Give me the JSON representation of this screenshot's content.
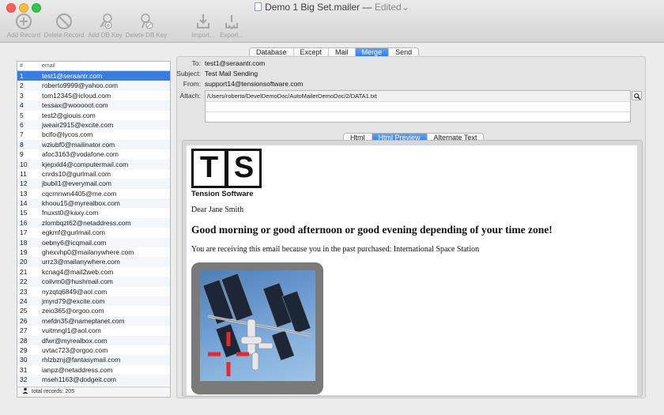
{
  "window": {
    "title": "Demo 1 Big Set.mailer",
    "separator": "—",
    "status": "Edited",
    "status_arrow": "⌄"
  },
  "toolbar": {
    "add_record": "Add Record",
    "delete_record": "Delete Record",
    "add_db_key": "Add DB Key",
    "delete_db_key": "Delete DB Key",
    "import": "Import...",
    "export": "Export..."
  },
  "main_tabs": {
    "database": "Database",
    "except": "Except",
    "mail": "Mail",
    "merge": "Merge",
    "send": "Send",
    "active": "Merge"
  },
  "list": {
    "col_num": "#",
    "col_email": "email",
    "rows": [
      {
        "n": "1",
        "email": "test1@seraantr.com"
      },
      {
        "n": "2",
        "email": "roberto9999@yahoo.com"
      },
      {
        "n": "3",
        "email": "tom12345@icloud.com"
      },
      {
        "n": "4",
        "email": "tessax@wooooot.com"
      },
      {
        "n": "5",
        "email": "test2@giouis.com"
      },
      {
        "n": "6",
        "email": "jweair2915@excite.com"
      },
      {
        "n": "7",
        "email": "bclfo@lycos.com"
      },
      {
        "n": "8",
        "email": "wziubf0@mailinator.com"
      },
      {
        "n": "9",
        "email": "afoc3163@vodafone.com"
      },
      {
        "n": "10",
        "email": "kjepxld4@computermail.com"
      },
      {
        "n": "11",
        "email": "cnrds10@gurlmail.com"
      },
      {
        "n": "12",
        "email": "jbubil1@everymail.com"
      },
      {
        "n": "13",
        "email": "cqcrnnwn4405@me.com"
      },
      {
        "n": "14",
        "email": "khoou15@myrealbox.com"
      },
      {
        "n": "15",
        "email": "fnuxst0@kaxy.com"
      },
      {
        "n": "16",
        "email": "zlombqzt62@netaddress.com"
      },
      {
        "n": "17",
        "email": "egkmf@gurlmail.com"
      },
      {
        "n": "18",
        "email": "oebny6@icqmail.com"
      },
      {
        "n": "19",
        "email": "ghexvhp0@mailanywhere.com"
      },
      {
        "n": "20",
        "email": "urrz3@mailanywhere.com"
      },
      {
        "n": "21",
        "email": "kcnag4@mail2web.com"
      },
      {
        "n": "22",
        "email": "coilvm0@hushmail.com"
      },
      {
        "n": "23",
        "email": "nyzqtq6849@aol.com"
      },
      {
        "n": "24",
        "email": "jmyrd79@excite.com"
      },
      {
        "n": "25",
        "email": "zeio365@orgoo.com"
      },
      {
        "n": "26",
        "email": "mefdn35@nameplanet.com"
      },
      {
        "n": "27",
        "email": "vuitmngl1@aol.com"
      },
      {
        "n": "28",
        "email": "dfwr@myrealbox.com"
      },
      {
        "n": "29",
        "email": "uvtac723@orgoo.com"
      },
      {
        "n": "30",
        "email": "rhlzbznj@fantasymail.com"
      },
      {
        "n": "31",
        "email": "ianpz@netaddress.com"
      },
      {
        "n": "32",
        "email": "mseh1163@dodgeit.com"
      }
    ],
    "footer": "total records: 205"
  },
  "message": {
    "to_label": "To:",
    "to_value": "test1@seraantr.com",
    "subject_label": "Subject:",
    "subject_value": "Test Mail Sending",
    "from_label": "From:",
    "from_value": "support14@tensionsoftware.com",
    "attach_label": "Attach:",
    "attach_value": "/Users/roberto/DevelDemoDoc/AutoMailerDemoDoc/2/DATA1.txt"
  },
  "preview_tabs": {
    "html": "Html",
    "html_preview": "Html Preview",
    "alternate_text": "Alternate Text",
    "active": "Html Preview"
  },
  "preview": {
    "logo_t": "T",
    "logo_s": "S",
    "logo_caption": "Tension Software",
    "greeting": "Dear Jane Smith",
    "heading": "Good morning or good afternoon or good evening depending of your time zone!",
    "body": "You are receiving this email because you in the past purchased: International Space Station"
  },
  "colors": {
    "selection": "#3a7de0",
    "tab_active": "#2f7ae6",
    "crosshair": "#e8262c"
  }
}
